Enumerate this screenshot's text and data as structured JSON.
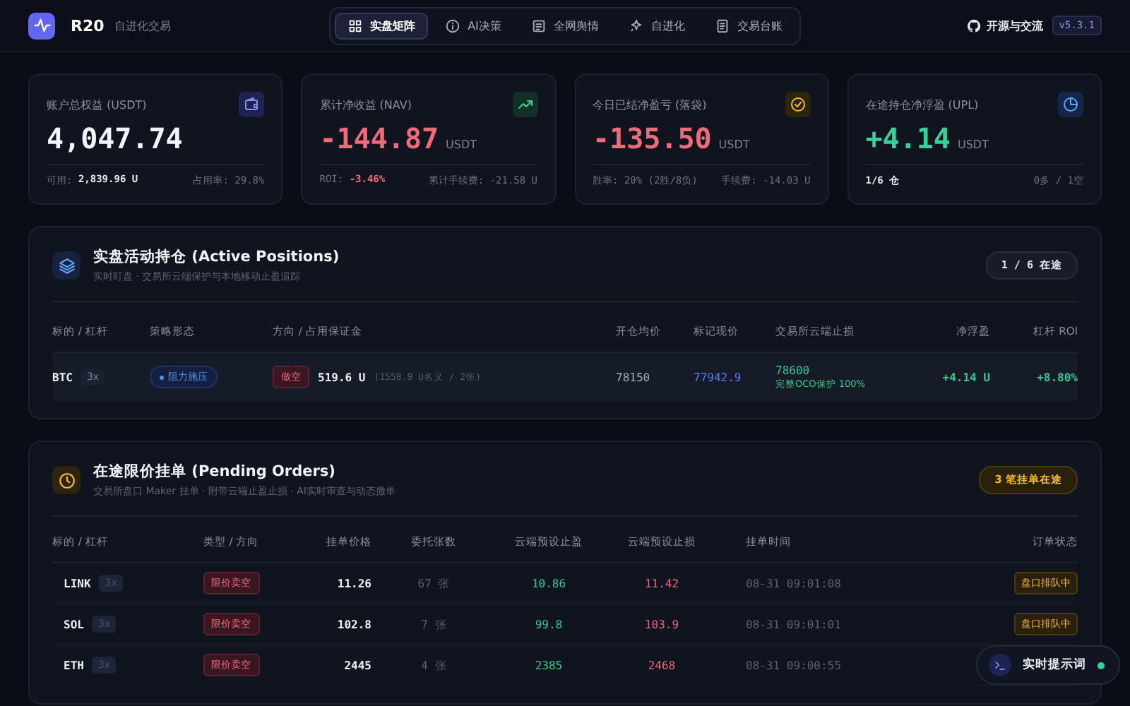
{
  "header": {
    "logo_text": "R20",
    "subtitle": "自进化交易",
    "tabs": [
      {
        "label": "实盘矩阵",
        "kind": "grid",
        "selected": true
      },
      {
        "label": "AI决策",
        "kind": "info",
        "selected": false
      },
      {
        "label": "全网舆情",
        "kind": "news",
        "selected": false
      },
      {
        "label": "自进化",
        "kind": "sparkle",
        "selected": false
      },
      {
        "label": "交易台账",
        "kind": "ledger",
        "selected": false
      }
    ],
    "github_link": "开源与交流",
    "version": "v5.3.1"
  },
  "stats": [
    {
      "label": "账户总权益 (USDT)",
      "kind": "wallet",
      "color": "#f3f4f7",
      "value": "4,047.74",
      "footer": {
        "label": "可用: ",
        "value": "2,839.96 U",
        "color": "#e6e8ee"
      },
      "footer_right": "占用率: 29.8%"
    },
    {
      "label": "累计净收益 (NAV)",
      "kind": "trend",
      "color": "#f06a7a",
      "value": "-144.87",
      "unit": "USDT",
      "footer": {
        "label": "ROI: ",
        "value": "-3.46%",
        "color": "#f06a7a"
      },
      "footer_right": "累计手续费: -21.58 U"
    },
    {
      "label": "今日已结净盈亏 (落袋)",
      "kind": "check",
      "color": "#f06a7a",
      "value": "-135.50",
      "unit": "USDT",
      "footer": {
        "label": "胜率: 20% (2胜/8负)"
      },
      "footer_right": "手续费: -14.03 U"
    },
    {
      "label": "在途持仓净浮盈 (UPL)",
      "kind": "pie",
      "color": "#34d399",
      "value": "+4.14",
      "unit": "USDT",
      "footer": {
        "value": "1/6 仓",
        "color": "#e6e8ee"
      },
      "footer_right": "0多 / 1空"
    }
  ],
  "positions": {
    "title": "实盘活动持仓 (Active Positions)",
    "subtitle": "实时盯盘 · 交易所云端保护与本地移动止盈追踪",
    "badge": "1 / 6 在途",
    "columns": [
      "标的 / 杠杆",
      "策略形态",
      "方向 / 占用保证金",
      "开仓均价",
      "标记现价",
      "交易所云端止损",
      "净浮盈",
      "杠杆 ROI"
    ],
    "rows": [
      {
        "symbol": "BTC",
        "leverage": "3x",
        "strategy": "阻力施压",
        "direction": "做空",
        "kind": "short",
        "margin": "519.6 U",
        "margin_note": "(1558.9 U名义 / 2张)",
        "entry": "78150",
        "mark": "77942.9",
        "stop": "78600",
        "stop_note": "完整OCO保护 100%",
        "pnl": "+4.14 U",
        "roi": "+8.80%"
      }
    ]
  },
  "orders": {
    "title": "在途限价挂单 (Pending Orders)",
    "subtitle": "交易所盘口 Maker 挂单 · 附带云端止盈止损 · AI实时审查与动态撤单",
    "badge": "3 笔挂单在途",
    "columns": [
      "标的 / 杠杆",
      "类型 / 方向",
      "挂单价格",
      "委托张数",
      "云端预设止盈",
      "云端预设止损",
      "挂单时间",
      "订单状态"
    ],
    "rows": [
      {
        "symbol": "LINK",
        "leverage": "3x",
        "type": "限价卖空",
        "kind": "short",
        "price": "11.26",
        "qty": "67 张",
        "tp": "10.86",
        "sl": "11.42",
        "time": "08-31 09:01:08",
        "status": "盘口排队中"
      },
      {
        "symbol": "SOL",
        "leverage": "3x",
        "type": "限价卖空",
        "kind": "short",
        "price": "102.8",
        "qty": "7 张",
        "tp": "99.8",
        "sl": "103.9",
        "time": "08-31 09:01:01",
        "status": "盘口排队中"
      },
      {
        "symbol": "ETH",
        "leverage": "3x",
        "type": "限价卖空",
        "kind": "short",
        "price": "2445",
        "qty": "4 张",
        "tp": "2385",
        "sl": "2468",
        "time": "08-31 09:00:55"
      }
    ]
  },
  "prompt_button": {
    "label": "实时提示词",
    "online": true
  }
}
